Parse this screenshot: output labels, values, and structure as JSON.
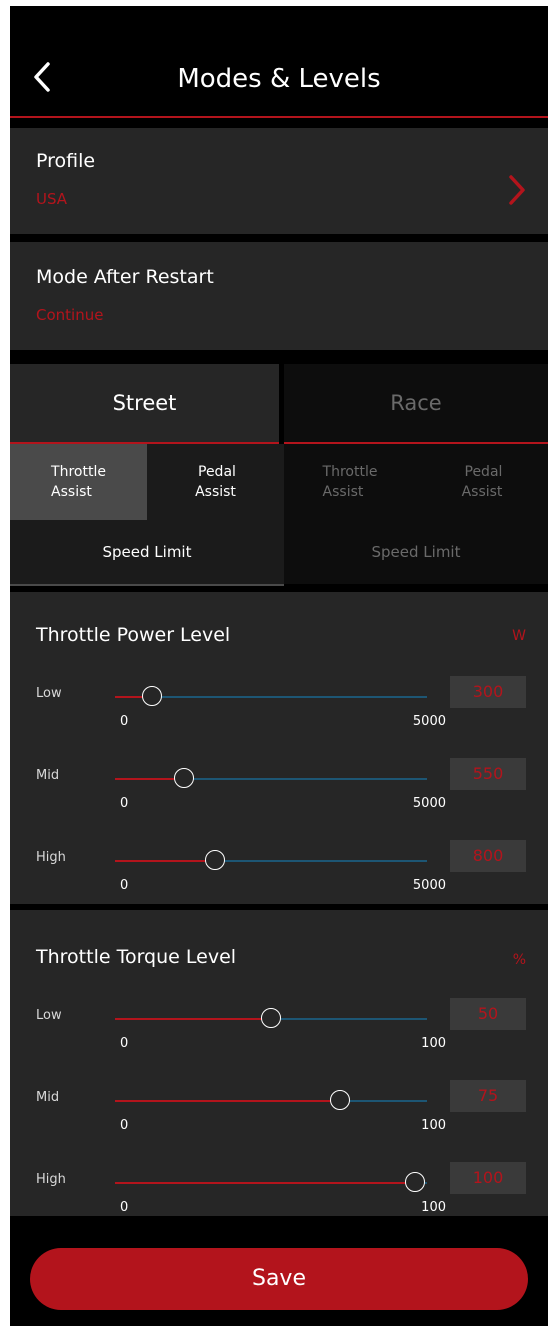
{
  "header": {
    "title": "Modes & Levels"
  },
  "profile": {
    "label": "Profile",
    "value": "USA"
  },
  "mode_after_restart": {
    "label": "Mode After Restart",
    "value": "Continue"
  },
  "tabs": [
    {
      "label": "Street"
    },
    {
      "label": "Race"
    }
  ],
  "subtabs": [
    {
      "line1": "Throttle",
      "line2": "Assist"
    },
    {
      "line1": "Pedal",
      "line2": "Assist"
    },
    {
      "line1": "Throttle",
      "line2": "Assist"
    },
    {
      "line1": "Pedal",
      "line2": "Assist"
    }
  ],
  "speed_tabs": [
    {
      "label": "Speed Limit"
    },
    {
      "label": "Speed Limit"
    }
  ],
  "power": {
    "title": "Throttle Power Level",
    "unit": "W",
    "rows": [
      {
        "label": "Low",
        "value": "300",
        "min": "0",
        "max": "5000",
        "fraction": 0.12
      },
      {
        "label": "Mid",
        "value": "550",
        "min": "0",
        "max": "5000",
        "fraction": 0.22
      },
      {
        "label": "High",
        "value": "800",
        "min": "0",
        "max": "5000",
        "fraction": 0.32
      }
    ]
  },
  "torque": {
    "title": "Throttle Torque Level",
    "unit": "%",
    "rows": [
      {
        "label": "Low",
        "value": "50",
        "min": "0",
        "max": "100",
        "fraction": 0.5
      },
      {
        "label": "Mid",
        "value": "75",
        "min": "0",
        "max": "100",
        "fraction": 0.72
      },
      {
        "label": "High",
        "value": "100",
        "min": "0",
        "max": "100",
        "fraction": 0.96
      }
    ]
  },
  "save": {
    "label": "Save"
  },
  "colors": {
    "accent": "#b3141c",
    "track": "#1d5674",
    "panel": "#262626"
  }
}
